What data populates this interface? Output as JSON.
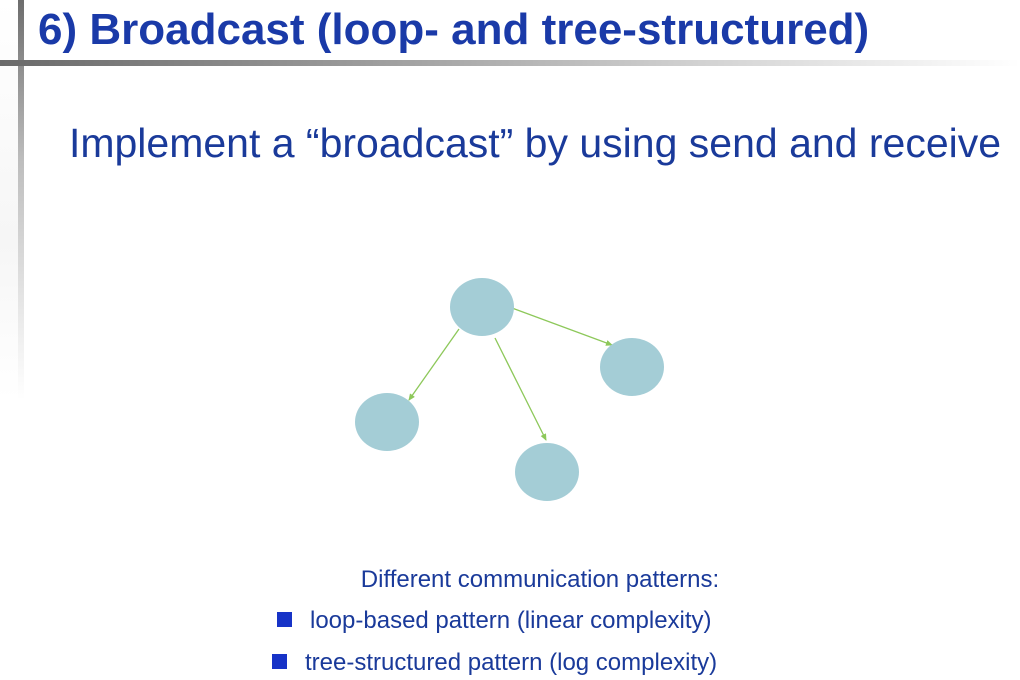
{
  "title": "6) Broadcast (loop- and tree-structured)",
  "subtitle": "Implement a “broadcast” by using send and receive",
  "patterns": {
    "heading": "Different communication patterns:",
    "items": [
      {
        "label": "loop-based pattern (linear complexity)"
      },
      {
        "label": "tree-structured pattern (log complexity)"
      }
    ]
  },
  "colors": {
    "title": "#1a3aa8",
    "text": "#1a3a9a",
    "node_fill": "#a4cdd6",
    "edge": "#8dc85a",
    "bullet": "#1733c7"
  }
}
